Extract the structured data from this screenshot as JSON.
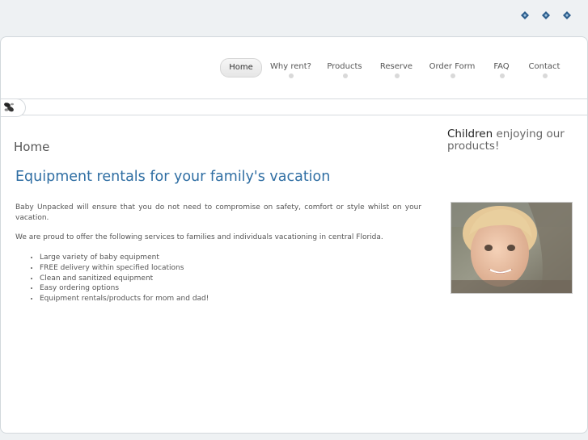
{
  "top_icons": [
    "paw-icon",
    "paw-icon",
    "paw-icon"
  ],
  "nav": {
    "items": [
      {
        "label": "Home",
        "active": true
      },
      {
        "label": "Why rent?",
        "active": false
      },
      {
        "label": "Products",
        "active": false
      },
      {
        "label": "Reserve",
        "active": false
      },
      {
        "label": "Order Form",
        "active": false
      },
      {
        "label": "FAQ",
        "active": false
      },
      {
        "label": "Contact",
        "active": false
      }
    ]
  },
  "main": {
    "section_title": "Home",
    "headline": "Equipment rentals for your family's vacation",
    "paragraph1": "Baby Unpacked will ensure that you do not need to compromise on safety, comfort or style whilst on your vacation.",
    "paragraph2": "We are proud to offer the following services to families and individuals vacationing in central Florida.",
    "services": [
      "Large variety of baby equipment",
      "FREE delivery within specified locations",
      "Clean and sanitized equipment",
      "Easy ordering options",
      "Equipment rentals/products for mom and dad!"
    ]
  },
  "sidebar": {
    "title_bold": "Children",
    "title_rest": " enjoying our products!"
  },
  "colors": {
    "accent": "#2f6ea3",
    "icon_blue": "#2a5d8c",
    "background": "#eef1f3"
  }
}
